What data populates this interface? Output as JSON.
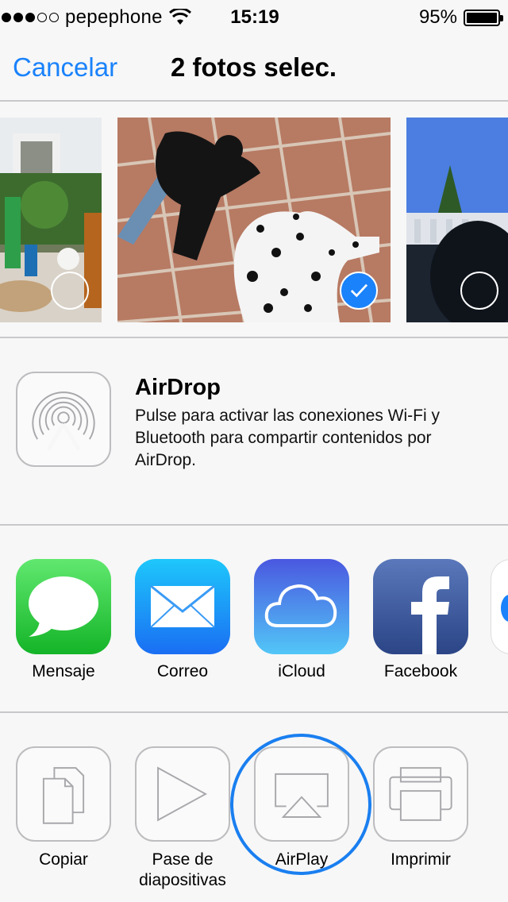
{
  "status_bar": {
    "carrier": "pepephone",
    "signal_bars": 3,
    "signal_total": 5,
    "time": "15:19",
    "battery": "95%",
    "battery_level": 0.95
  },
  "nav": {
    "cancel": "Cancelar",
    "title": "2 fotos selec."
  },
  "photos": [
    {
      "selected": false
    },
    {
      "selected": true
    },
    {
      "selected": false
    }
  ],
  "airdrop": {
    "title": "AirDrop",
    "description": "Pulse para activar las conexiones Wi-Fi y Bluetooth para compartir contenidos por AirDrop."
  },
  "apps": [
    {
      "label": "Mensaje",
      "icon": "messages-icon"
    },
    {
      "label": "Correo",
      "icon": "mail-icon"
    },
    {
      "label": "iCloud",
      "icon": "icloud-icon"
    },
    {
      "label": "Facebook",
      "icon": "facebook-icon"
    }
  ],
  "actions": [
    {
      "label": "Copiar",
      "icon": "copy-icon"
    },
    {
      "label": "Pase de diapositivas",
      "icon": "slideshow-icon"
    },
    {
      "label": "AirPlay",
      "icon": "airplay-icon"
    },
    {
      "label": "Imprimir",
      "icon": "print-icon"
    }
  ],
  "colors": {
    "accent": "#1a82fb",
    "messages": "#2fcf3e",
    "mail": "#1d8ff5",
    "icloud": "#5a8ff0",
    "facebook": "#3b5a9a"
  }
}
